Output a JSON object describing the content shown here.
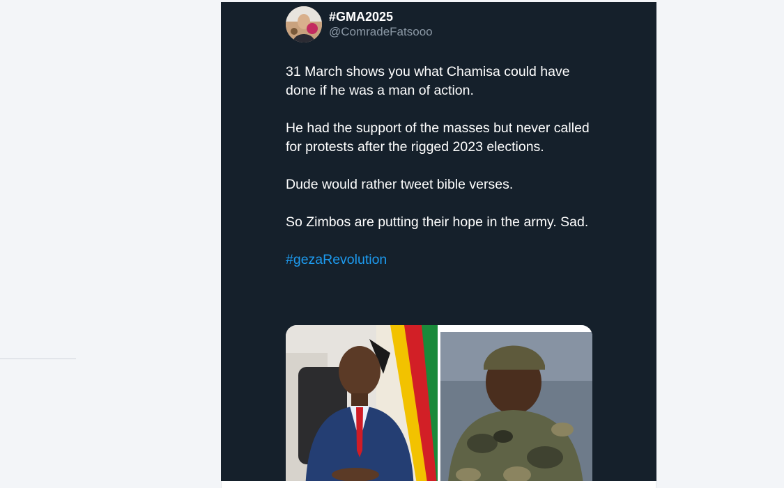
{
  "tweet": {
    "display_name": "#GMA2025",
    "handle": "@ComradeFatsooo",
    "paragraphs": [
      "31 March shows you what Chamisa could have done if he was a man of action.",
      "He had the support of the masses but never called for protests after the rigged 2023 elections.",
      "Dude would rather tweet bible verses.",
      "So Zimbos are putting their hope in the army. Sad."
    ],
    "hashtag": "#gezaRevolution"
  },
  "colors": {
    "page_bg": "#f3f5f8",
    "card_bg": "#15202b",
    "text": "#ffffff",
    "muted": "#8b98a5",
    "link": "#1d9bf0"
  }
}
